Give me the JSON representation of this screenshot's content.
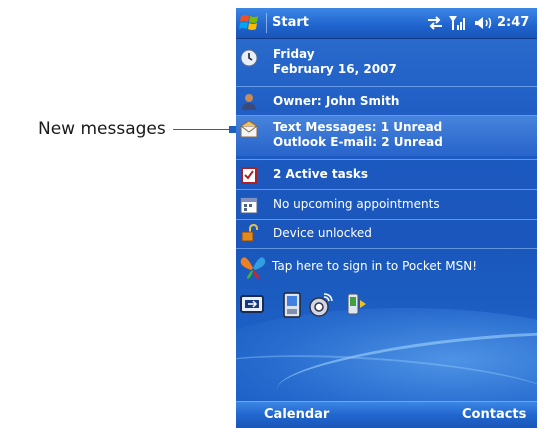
{
  "callout": {
    "label": "New messages"
  },
  "titlebar": {
    "title": "Start",
    "time": "2:47"
  },
  "today": {
    "date_day": "Friday",
    "date_full": "February 16, 2007",
    "owner": "Owner: John Smith",
    "text_messages": "Text Messages: 1 Unread",
    "outlook_email": "Outlook E-mail: 2 Unread",
    "tasks": "2 Active tasks",
    "appointments": "No upcoming appointments",
    "device_lock": "Device unlocked",
    "msn": "Tap here to sign in to Pocket MSN!"
  },
  "softkeys": {
    "left": "Calendar",
    "right": "Contacts"
  },
  "colors": {
    "screen_blue": "#1d5ac1",
    "callout_blue": "#1f5fbf"
  },
  "icons": [
    "windows-start-flag-icon",
    "connectivity-icon",
    "signal-icon",
    "volume-icon",
    "clock-icon",
    "owner-icon",
    "messaging-icon",
    "tasks-icon",
    "calendar-icon",
    "lock-icon",
    "msn-butterfly-icon",
    "comm-manager-icon",
    "phone-icon",
    "wireless-icon",
    "sync-icon"
  ]
}
